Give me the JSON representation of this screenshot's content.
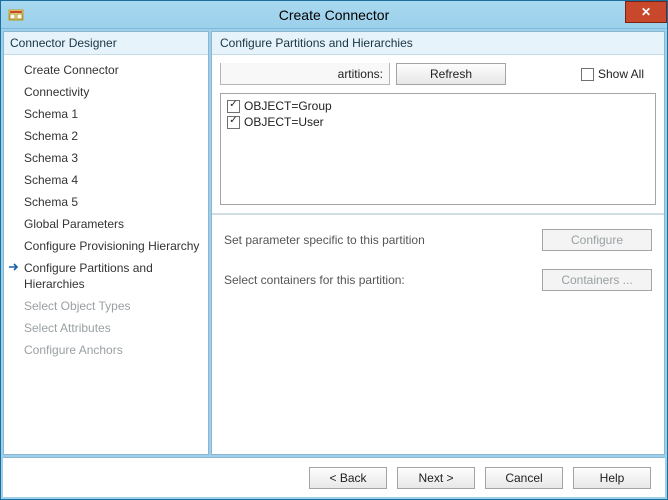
{
  "window": {
    "title": "Create Connector"
  },
  "sidebar": {
    "header": "Connector Designer",
    "items": [
      {
        "label": "Create Connector",
        "state": "normal"
      },
      {
        "label": "Connectivity",
        "state": "normal"
      },
      {
        "label": "Schema 1",
        "state": "normal"
      },
      {
        "label": "Schema 2",
        "state": "normal"
      },
      {
        "label": "Schema 3",
        "state": "normal"
      },
      {
        "label": "Schema 4",
        "state": "normal"
      },
      {
        "label": "Schema 5",
        "state": "normal"
      },
      {
        "label": "Global Parameters",
        "state": "normal"
      },
      {
        "label": "Configure Provisioning Hierarchy",
        "state": "normal"
      },
      {
        "label": "Configure Partitions and Hierarchies",
        "state": "active"
      },
      {
        "label": "Select Object Types",
        "state": "disabled"
      },
      {
        "label": "Select Attributes",
        "state": "disabled"
      },
      {
        "label": "Configure Anchors",
        "state": "disabled"
      }
    ]
  },
  "main": {
    "header": "Configure Partitions and Hierarchies",
    "toolbar": {
      "label_fragment": "artitions:",
      "refresh": "Refresh",
      "show_all": "Show All",
      "show_all_checked": false
    },
    "partitions": [
      {
        "label": "OBJECT=Group",
        "checked": true
      },
      {
        "label": "OBJECT=User",
        "checked": true
      }
    ],
    "param_row": {
      "label": "Set parameter specific to this partition",
      "button": "Configure",
      "enabled": false
    },
    "containers_row": {
      "label": "Select containers for this partition:",
      "button": "Containers ...",
      "enabled": false
    }
  },
  "footer": {
    "back": "<  Back",
    "next": "Next  >",
    "cancel": "Cancel",
    "help": "Help"
  }
}
